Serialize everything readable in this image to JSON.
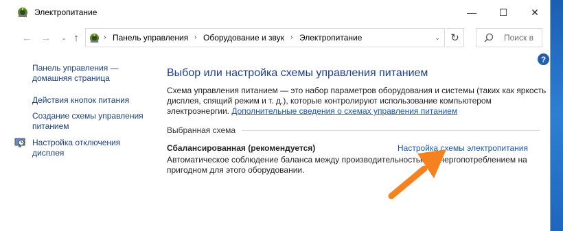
{
  "window": {
    "title": "Электропитание",
    "min_glyph": "—",
    "max_glyph": "☐",
    "close_glyph": "✕"
  },
  "nav": {
    "back_glyph": "←",
    "forward_glyph": "→",
    "dropdown_glyph": "⌄",
    "up_glyph": "↑",
    "breadcrumbs": [
      "Панель управления",
      "Оборудование и звук",
      "Электропитание"
    ],
    "crumb_sep": "›",
    "refresh_glyph": "↻",
    "search_placeholder": "Поиск в"
  },
  "help": {
    "glyph": "?"
  },
  "sidebar": {
    "home": "Панель управления — домашняя страница",
    "buttons": "Действия кнопок питания",
    "create": "Создание схемы управления питанием",
    "display": "Настройка отключения дисплея"
  },
  "main": {
    "title": "Выбор или настройка схемы управления питанием",
    "desc": "Схема управления питанием — это набор параметров оборудования и системы (таких как яркость дисплея, спящий режим и т. д.), которые контролируют использование компьютером электроэнергии.",
    "more_link": "Дополнительные сведения о схемах управления питанием",
    "section_label": "Выбранная схема",
    "plan_name": "Сбалансированная (рекомендуется)",
    "plan_link": "Настройка схемы электропитания",
    "plan_desc": "Автоматическое соблюдение баланса между производительностью и энергопотреблением на пригодном для этого оборудовании."
  },
  "colors": {
    "link": "#1a55b5",
    "title": "#1e3d8c",
    "arrow": "#f5821f"
  }
}
